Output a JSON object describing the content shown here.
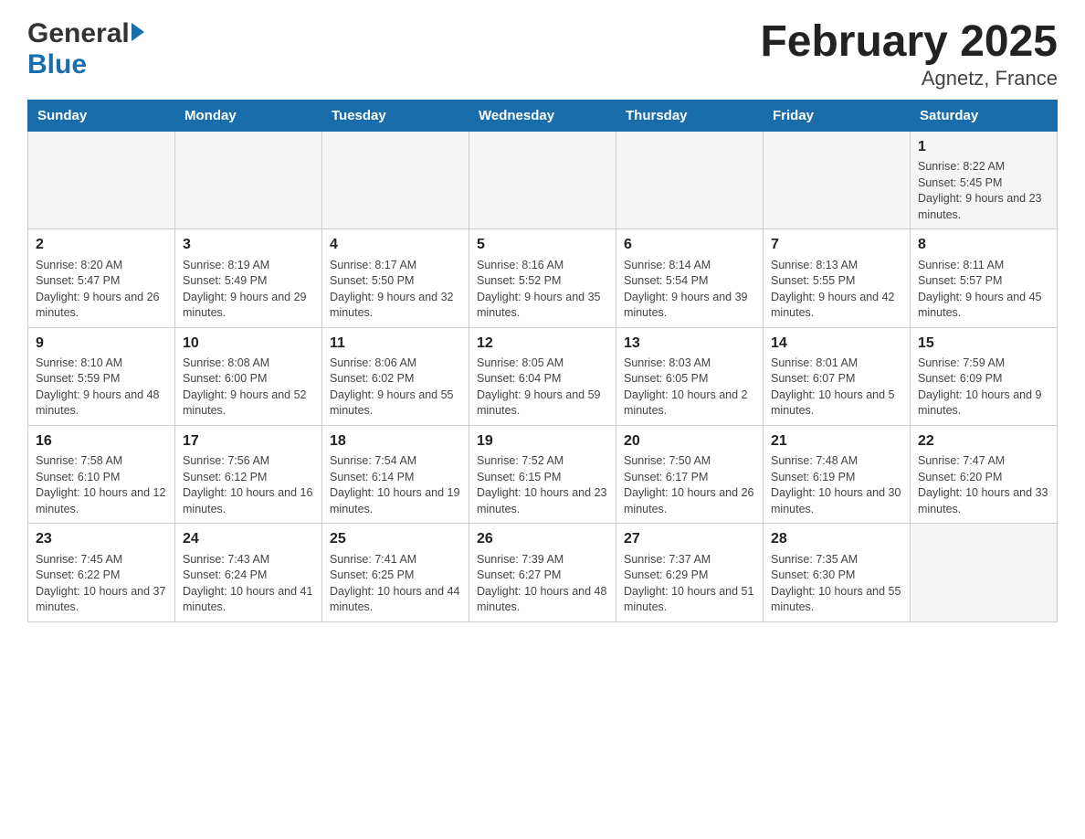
{
  "logo": {
    "general": "General",
    "blue": "Blue"
  },
  "title": "February 2025",
  "subtitle": "Agnetz, France",
  "days_of_week": [
    "Sunday",
    "Monday",
    "Tuesday",
    "Wednesday",
    "Thursday",
    "Friday",
    "Saturday"
  ],
  "weeks": [
    [
      {
        "day": "",
        "sunrise": "",
        "sunset": "",
        "daylight": ""
      },
      {
        "day": "",
        "sunrise": "",
        "sunset": "",
        "daylight": ""
      },
      {
        "day": "",
        "sunrise": "",
        "sunset": "",
        "daylight": ""
      },
      {
        "day": "",
        "sunrise": "",
        "sunset": "",
        "daylight": ""
      },
      {
        "day": "",
        "sunrise": "",
        "sunset": "",
        "daylight": ""
      },
      {
        "day": "",
        "sunrise": "",
        "sunset": "",
        "daylight": ""
      },
      {
        "day": "1",
        "sunrise": "Sunrise: 8:22 AM",
        "sunset": "Sunset: 5:45 PM",
        "daylight": "Daylight: 9 hours and 23 minutes."
      }
    ],
    [
      {
        "day": "2",
        "sunrise": "Sunrise: 8:20 AM",
        "sunset": "Sunset: 5:47 PM",
        "daylight": "Daylight: 9 hours and 26 minutes."
      },
      {
        "day": "3",
        "sunrise": "Sunrise: 8:19 AM",
        "sunset": "Sunset: 5:49 PM",
        "daylight": "Daylight: 9 hours and 29 minutes."
      },
      {
        "day": "4",
        "sunrise": "Sunrise: 8:17 AM",
        "sunset": "Sunset: 5:50 PM",
        "daylight": "Daylight: 9 hours and 32 minutes."
      },
      {
        "day": "5",
        "sunrise": "Sunrise: 8:16 AM",
        "sunset": "Sunset: 5:52 PM",
        "daylight": "Daylight: 9 hours and 35 minutes."
      },
      {
        "day": "6",
        "sunrise": "Sunrise: 8:14 AM",
        "sunset": "Sunset: 5:54 PM",
        "daylight": "Daylight: 9 hours and 39 minutes."
      },
      {
        "day": "7",
        "sunrise": "Sunrise: 8:13 AM",
        "sunset": "Sunset: 5:55 PM",
        "daylight": "Daylight: 9 hours and 42 minutes."
      },
      {
        "day": "8",
        "sunrise": "Sunrise: 8:11 AM",
        "sunset": "Sunset: 5:57 PM",
        "daylight": "Daylight: 9 hours and 45 minutes."
      }
    ],
    [
      {
        "day": "9",
        "sunrise": "Sunrise: 8:10 AM",
        "sunset": "Sunset: 5:59 PM",
        "daylight": "Daylight: 9 hours and 48 minutes."
      },
      {
        "day": "10",
        "sunrise": "Sunrise: 8:08 AM",
        "sunset": "Sunset: 6:00 PM",
        "daylight": "Daylight: 9 hours and 52 minutes."
      },
      {
        "day": "11",
        "sunrise": "Sunrise: 8:06 AM",
        "sunset": "Sunset: 6:02 PM",
        "daylight": "Daylight: 9 hours and 55 minutes."
      },
      {
        "day": "12",
        "sunrise": "Sunrise: 8:05 AM",
        "sunset": "Sunset: 6:04 PM",
        "daylight": "Daylight: 9 hours and 59 minutes."
      },
      {
        "day": "13",
        "sunrise": "Sunrise: 8:03 AM",
        "sunset": "Sunset: 6:05 PM",
        "daylight": "Daylight: 10 hours and 2 minutes."
      },
      {
        "day": "14",
        "sunrise": "Sunrise: 8:01 AM",
        "sunset": "Sunset: 6:07 PM",
        "daylight": "Daylight: 10 hours and 5 minutes."
      },
      {
        "day": "15",
        "sunrise": "Sunrise: 7:59 AM",
        "sunset": "Sunset: 6:09 PM",
        "daylight": "Daylight: 10 hours and 9 minutes."
      }
    ],
    [
      {
        "day": "16",
        "sunrise": "Sunrise: 7:58 AM",
        "sunset": "Sunset: 6:10 PM",
        "daylight": "Daylight: 10 hours and 12 minutes."
      },
      {
        "day": "17",
        "sunrise": "Sunrise: 7:56 AM",
        "sunset": "Sunset: 6:12 PM",
        "daylight": "Daylight: 10 hours and 16 minutes."
      },
      {
        "day": "18",
        "sunrise": "Sunrise: 7:54 AM",
        "sunset": "Sunset: 6:14 PM",
        "daylight": "Daylight: 10 hours and 19 minutes."
      },
      {
        "day": "19",
        "sunrise": "Sunrise: 7:52 AM",
        "sunset": "Sunset: 6:15 PM",
        "daylight": "Daylight: 10 hours and 23 minutes."
      },
      {
        "day": "20",
        "sunrise": "Sunrise: 7:50 AM",
        "sunset": "Sunset: 6:17 PM",
        "daylight": "Daylight: 10 hours and 26 minutes."
      },
      {
        "day": "21",
        "sunrise": "Sunrise: 7:48 AM",
        "sunset": "Sunset: 6:19 PM",
        "daylight": "Daylight: 10 hours and 30 minutes."
      },
      {
        "day": "22",
        "sunrise": "Sunrise: 7:47 AM",
        "sunset": "Sunset: 6:20 PM",
        "daylight": "Daylight: 10 hours and 33 minutes."
      }
    ],
    [
      {
        "day": "23",
        "sunrise": "Sunrise: 7:45 AM",
        "sunset": "Sunset: 6:22 PM",
        "daylight": "Daylight: 10 hours and 37 minutes."
      },
      {
        "day": "24",
        "sunrise": "Sunrise: 7:43 AM",
        "sunset": "Sunset: 6:24 PM",
        "daylight": "Daylight: 10 hours and 41 minutes."
      },
      {
        "day": "25",
        "sunrise": "Sunrise: 7:41 AM",
        "sunset": "Sunset: 6:25 PM",
        "daylight": "Daylight: 10 hours and 44 minutes."
      },
      {
        "day": "26",
        "sunrise": "Sunrise: 7:39 AM",
        "sunset": "Sunset: 6:27 PM",
        "daylight": "Daylight: 10 hours and 48 minutes."
      },
      {
        "day": "27",
        "sunrise": "Sunrise: 7:37 AM",
        "sunset": "Sunset: 6:29 PM",
        "daylight": "Daylight: 10 hours and 51 minutes."
      },
      {
        "day": "28",
        "sunrise": "Sunrise: 7:35 AM",
        "sunset": "Sunset: 6:30 PM",
        "daylight": "Daylight: 10 hours and 55 minutes."
      },
      {
        "day": "",
        "sunrise": "",
        "sunset": "",
        "daylight": ""
      }
    ]
  ]
}
